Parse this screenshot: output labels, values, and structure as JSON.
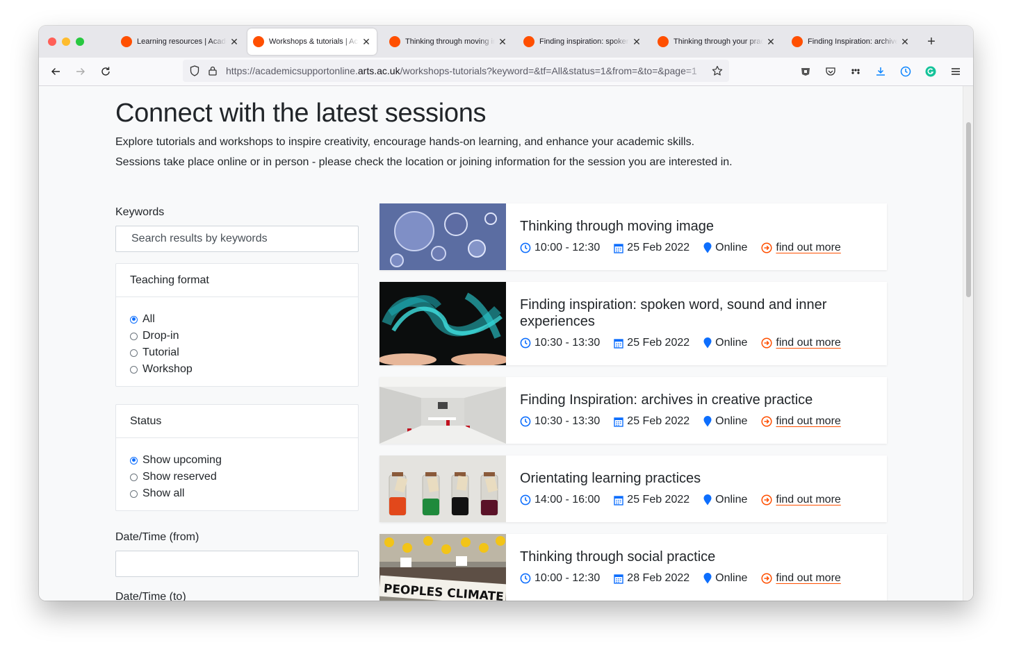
{
  "browser": {
    "tabs": [
      {
        "title": "Learning resources | Academic Support Online",
        "active": false
      },
      {
        "title": "Workshops & tutorials | Academic Support Online",
        "active": true
      },
      {
        "title": "Thinking through moving image",
        "active": false
      },
      {
        "title": "Finding inspiration: spoken word, sound and inner experiences",
        "active": false
      },
      {
        "title": "Thinking through your practice",
        "active": false
      },
      {
        "title": "Finding Inspiration: archives in creative practice",
        "active": false
      }
    ],
    "new_tab_label": "+",
    "url_prefix": "https://academicsupportonline.",
    "url_domain": "arts.ac.uk",
    "url_path": "/workshops-tutorials?keyword=&tf=All&status=1&from=&to=&page=1",
    "accent_color": "#ff4f00"
  },
  "header": {
    "title": "Connect with the latest sessions",
    "intro_1": "Explore tutorials and workshops to inspire creativity, encourage hands-on learning, and enhance your academic skills.",
    "intro_2": "Sessions take place online or in person - please check the location or joining information for the session you are interested in."
  },
  "filters": {
    "keywords_label": "Keywords",
    "keywords_placeholder": "Search results by keywords",
    "teaching_format": {
      "title": "Teaching format",
      "options": [
        "All",
        "Drop-in",
        "Tutorial",
        "Workshop"
      ],
      "selected": "All"
    },
    "status": {
      "title": "Status",
      "options": [
        "Show upcoming",
        "Show reserved",
        "Show all"
      ],
      "selected": "Show upcoming"
    },
    "from_label": "Date/Time (from)",
    "to_label": "Date/Time (to)"
  },
  "results": [
    {
      "title": "Thinking through moving image",
      "time": "10:00 - 12:30",
      "date": "25 Feb 2022",
      "location": "Online",
      "link": "find out more",
      "image": "blue-bubbles-image"
    },
    {
      "title": "Finding inspiration: spoken word, sound and inner experiences",
      "time": "10:30 - 13:30",
      "date": "25 Feb 2022",
      "location": "Online",
      "link": "find out more",
      "image": "hands-turquoise-smoke-image"
    },
    {
      "title": "Finding Inspiration: archives in creative practice",
      "time": "10:30 - 13:30",
      "date": "25 Feb 2022",
      "location": "Online",
      "link": "find out more",
      "image": "archive-room-image"
    },
    {
      "title": "Orientating learning practices",
      "time": "14:00 - 16:00",
      "date": "25 Feb 2022",
      "location": "Online",
      "link": "find out more",
      "image": "labelled-jars-image"
    },
    {
      "title": "Thinking through social practice",
      "time": "10:00 - 12:30",
      "date": "28 Feb 2022",
      "location": "Online",
      "link": "find out more",
      "image": "climate-march-image"
    }
  ],
  "icon_color": "#0d6efd"
}
